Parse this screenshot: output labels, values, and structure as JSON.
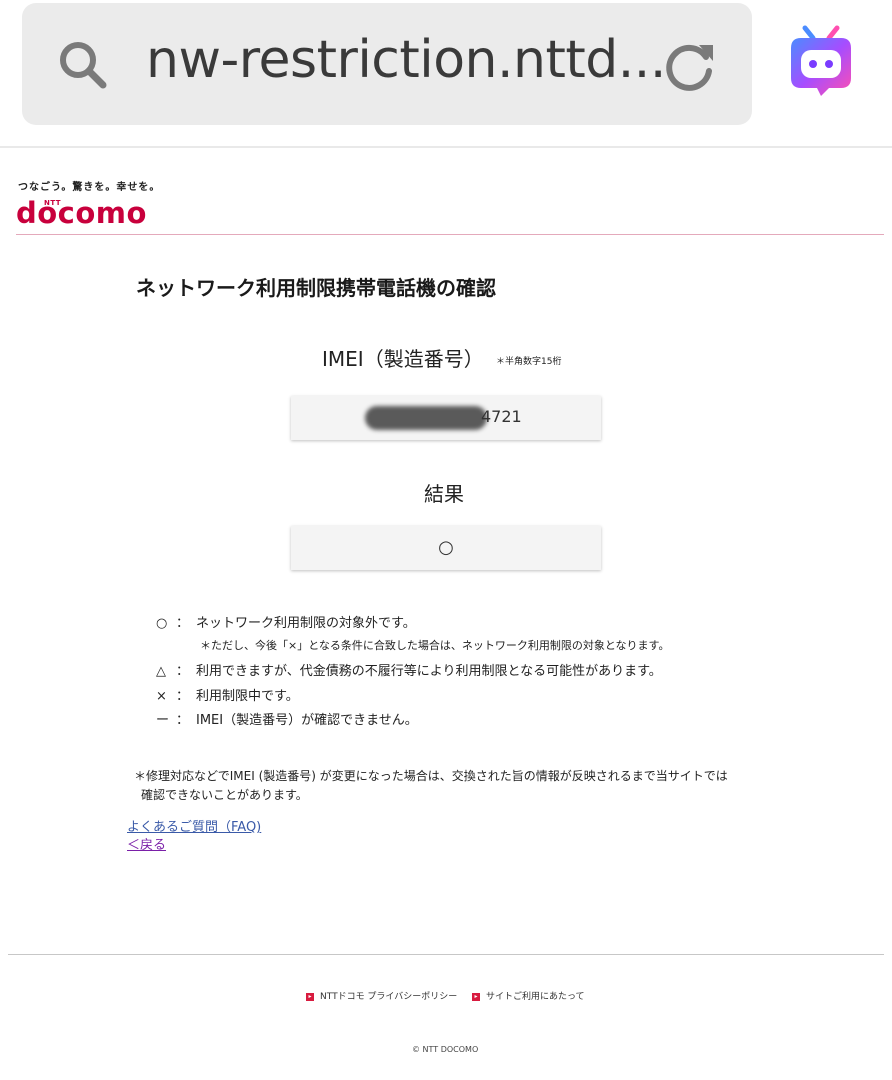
{
  "browser": {
    "url": "nw-restriction.nttd...",
    "icons": {
      "search": "search-icon",
      "reload": "reload-icon",
      "assistant": "assistant-bot-icon"
    },
    "assistant_colors": [
      "#4b8cff",
      "#a64dff",
      "#ff4fb0"
    ]
  },
  "header": {
    "tagline": "つなごう。驚きを。幸せを。",
    "logo_small": "NTT",
    "logo": "docomo",
    "brand_color": "#c8003c"
  },
  "page": {
    "title": "ネットワーク利用制限携帯電話機の確認",
    "imei_label": "IMEI（製造番号）",
    "imei_note": "＊半角数字15桁",
    "imei_value": "4721",
    "result_label": "結果",
    "result_value": "○"
  },
  "legend": [
    {
      "symbol": "○",
      "colon": "：",
      "text": "ネットワーク利用制限の対象外です。"
    },
    {
      "symbol": "△",
      "colon": "：",
      "text": "利用できますが、代金債務の不履行等により利用制限となる可能性があります。"
    },
    {
      "symbol": "×",
      "colon": "：",
      "text": "利用制限中です。"
    },
    {
      "symbol": "ー",
      "colon": "：",
      "text": "IMEI（製造番号）が確認できません。"
    }
  ],
  "legend_sub": "＊ただし、今後「×」となる条件に合致した場合は、ネットワーク利用制限の対象となります。",
  "footnote": {
    "line1": "＊修理対応などでIMEI (製造番号) が変更になった場合は、交換された旨の情報が反映されるまで当サイトでは",
    "line2": "確認できないことがあります。"
  },
  "links": {
    "faq": "よくあるご質問（FAQ)",
    "back": "＜戻る"
  },
  "footer": {
    "privacy": "NTTドコモ プライバシーポリシー",
    "terms": "サイトご利用にあたって",
    "copyright": "© NTT DOCOMO"
  }
}
